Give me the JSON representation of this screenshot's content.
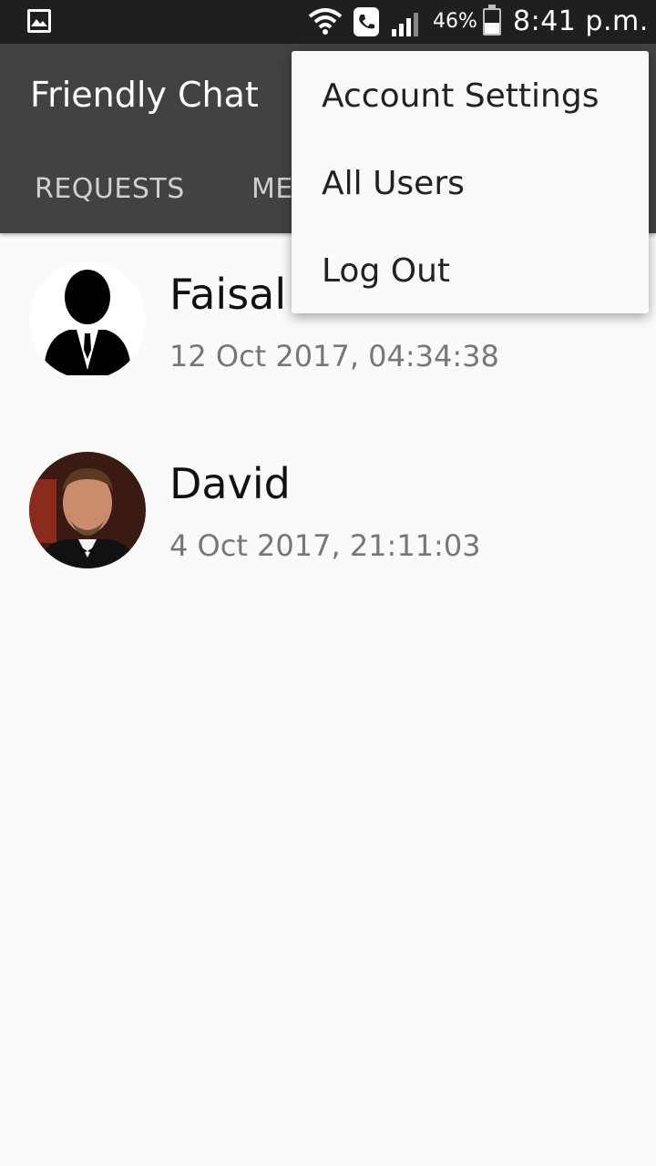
{
  "status_bar": {
    "battery_percent": "46%",
    "battery_level": 0.46,
    "time": "8:41 p.m.",
    "icons": [
      "gallery-icon",
      "wifi-icon",
      "call-icon",
      "signal-icon",
      "battery-icon"
    ]
  },
  "app_bar": {
    "title": "Friendly Chat",
    "background": "#424242",
    "tabs": [
      {
        "label": "REQUESTS"
      },
      {
        "label": "ME"
      }
    ]
  },
  "list": {
    "items": [
      {
        "name": "Faisal",
        "timestamp": "12 Oct 2017, 04:34:38",
        "avatar": "default-person-avatar"
      },
      {
        "name": "David",
        "timestamp": "4 Oct 2017, 21:11:03",
        "avatar": "photo-avatar"
      }
    ]
  },
  "overflow_menu": {
    "items": [
      {
        "label": "Account Settings"
      },
      {
        "label": "All Users"
      },
      {
        "label": "Log Out"
      }
    ]
  }
}
